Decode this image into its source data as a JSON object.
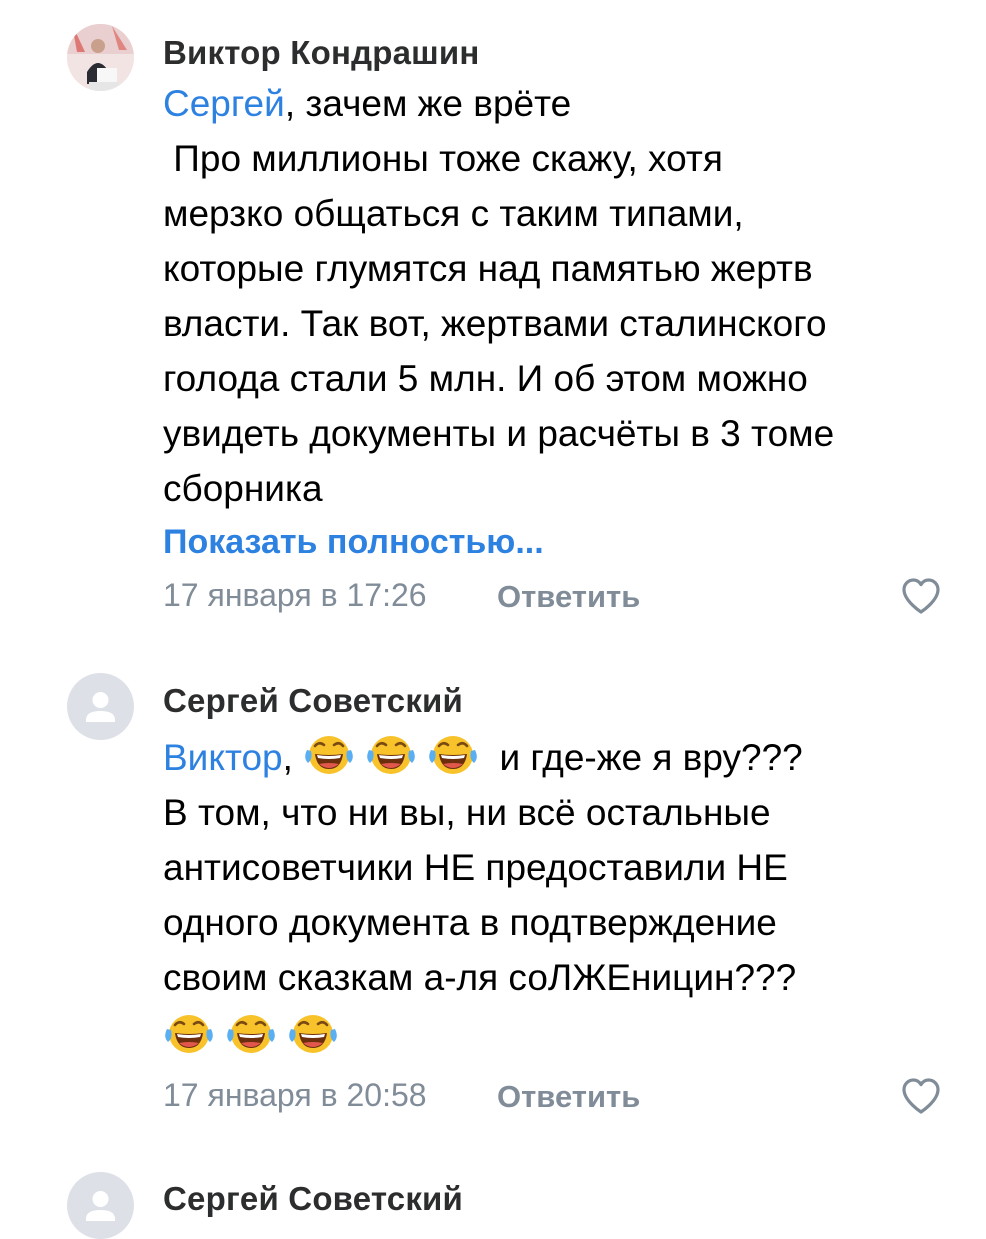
{
  "comments": [
    {
      "author": "Виктор Кондрашин",
      "avatar": "user-photo",
      "mention": "Сергей",
      "first_line_rest": ", зачем же врёте",
      "lines": [
        " Про миллионы тоже скажу, хотя",
        "мерзко общаться с таким типами,",
        "которые глумятся над памятью жертв",
        "власти. Так вот, жертвами сталинского",
        "голода стали 5 млн. И об этом можно",
        "увидеть документы и расчёты в 3 томе",
        "сборника"
      ],
      "show_more": "Показать полностью...",
      "date": "17 января в 17:26",
      "reply_label": "Ответить",
      "like_icon": "heart-outline-icon"
    },
    {
      "author": "Сергей Советский",
      "avatar": "default-user-icon",
      "mention": "Виктор",
      "first_line_rest": ", ",
      "first_line_emojis": [
        "face-with-tears-of-joy",
        "face-with-tears-of-joy",
        "face-with-tears-of-joy"
      ],
      "first_line_after_emojis": " и где-же я вру???",
      "lines": [
        "В том, что ни вы, ни всё остальные",
        "антисоветчики НЕ предоставили НЕ",
        "одного документа в подтверждение",
        "своим сказкам а-ля соЛЖЕницин???"
      ],
      "trailing_emojis": [
        "face-with-tears-of-joy",
        "face-with-tears-of-joy",
        "face-with-tears-of-joy"
      ],
      "date": "17 января в 20:58",
      "reply_label": "Ответить",
      "like_icon": "heart-outline-icon"
    },
    {
      "author": "Сергей Советский",
      "avatar": "default-user-icon"
    }
  ],
  "colors": {
    "link": "#2d81e0",
    "meta": "#818c99",
    "author": "#2c2d2e",
    "avatar_placeholder": "#dde1e7"
  }
}
